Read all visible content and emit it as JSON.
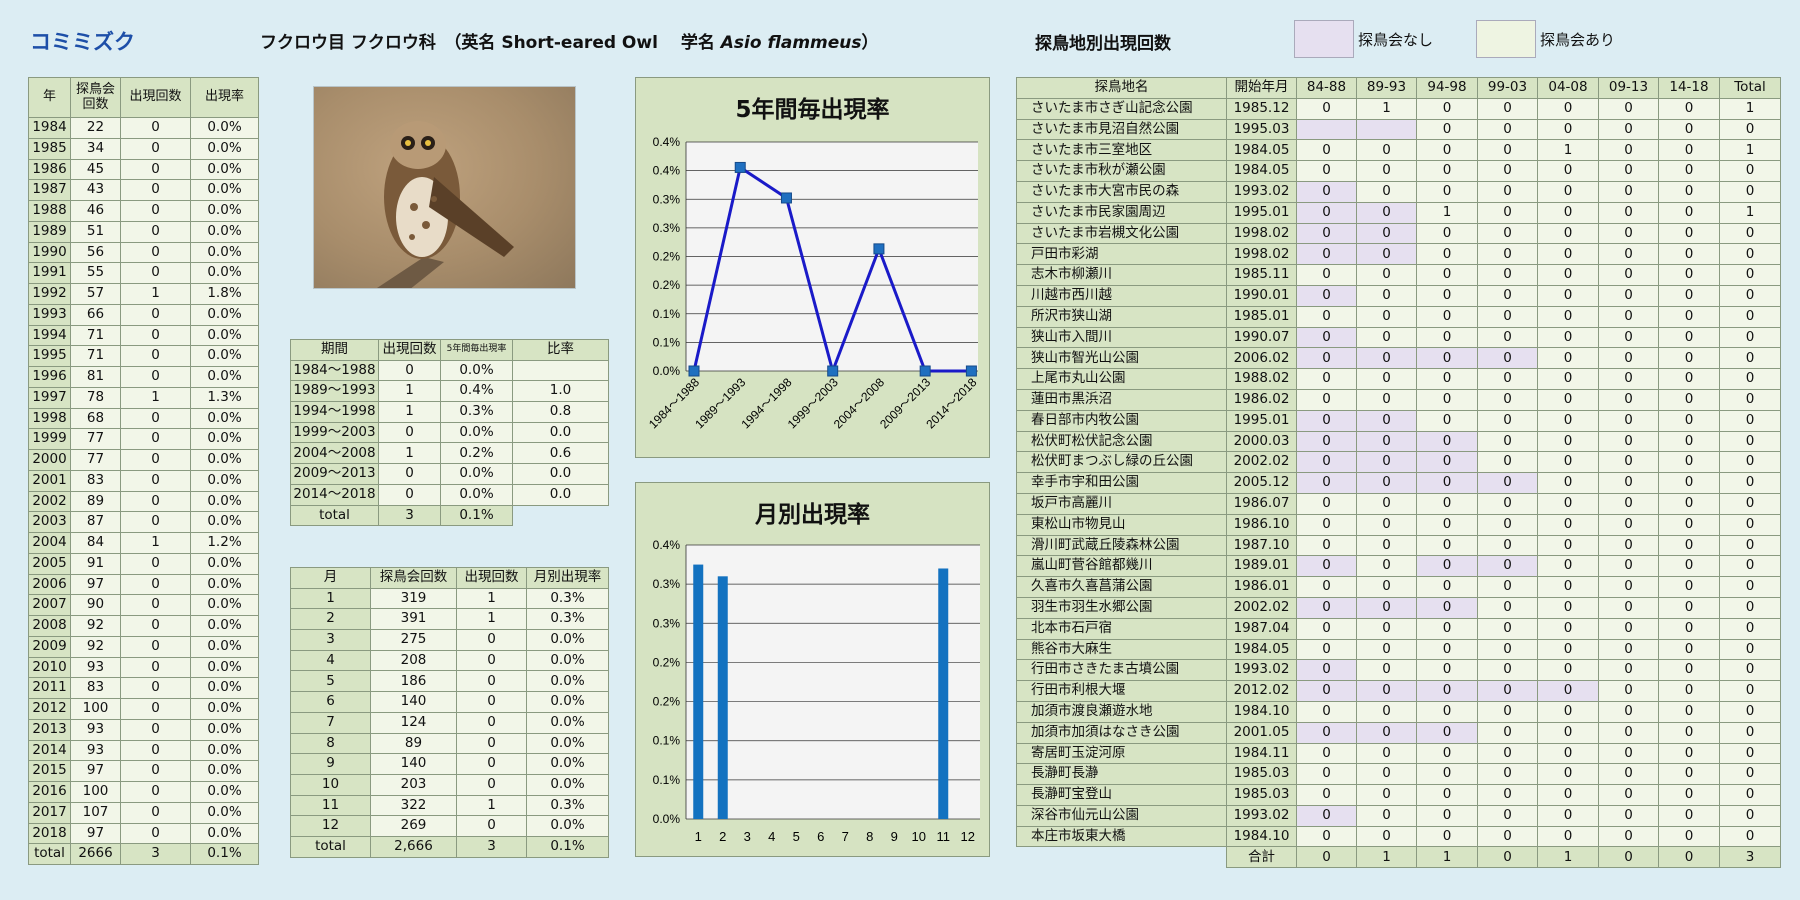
{
  "header": {
    "species": "コミミズク",
    "taxon_prefix": "フクロウ目 フクロウ科　（英名 Short-eared Owl　 学名 ",
    "taxon_latin": "Asio flammeus",
    "taxon_suffix": "）",
    "sites_title": "探鳥地別出現回数",
    "legend_none": "探鳥会なし",
    "legend_held": "探鳥会あり",
    "legend_none_color": "#e6e0f0",
    "legend_held_color": "#eef4e2"
  },
  "photo": {
    "icon": "owl-photo-icon"
  },
  "yearly": {
    "headers": [
      "年",
      "探鳥会回数",
      "出現回数",
      "出現率"
    ],
    "rows": [
      [
        "1984",
        "22",
        "0",
        "0.0%"
      ],
      [
        "1985",
        "34",
        "0",
        "0.0%"
      ],
      [
        "1986",
        "45",
        "0",
        "0.0%"
      ],
      [
        "1987",
        "43",
        "0",
        "0.0%"
      ],
      [
        "1988",
        "46",
        "0",
        "0.0%"
      ],
      [
        "1989",
        "51",
        "0",
        "0.0%"
      ],
      [
        "1990",
        "56",
        "0",
        "0.0%"
      ],
      [
        "1991",
        "55",
        "0",
        "0.0%"
      ],
      [
        "1992",
        "57",
        "1",
        "1.8%"
      ],
      [
        "1993",
        "66",
        "0",
        "0.0%"
      ],
      [
        "1994",
        "71",
        "0",
        "0.0%"
      ],
      [
        "1995",
        "71",
        "0",
        "0.0%"
      ],
      [
        "1996",
        "81",
        "0",
        "0.0%"
      ],
      [
        "1997",
        "78",
        "1",
        "1.3%"
      ],
      [
        "1998",
        "68",
        "0",
        "0.0%"
      ],
      [
        "1999",
        "77",
        "0",
        "0.0%"
      ],
      [
        "2000",
        "77",
        "0",
        "0.0%"
      ],
      [
        "2001",
        "83",
        "0",
        "0.0%"
      ],
      [
        "2002",
        "89",
        "0",
        "0.0%"
      ],
      [
        "2003",
        "87",
        "0",
        "0.0%"
      ],
      [
        "2004",
        "84",
        "1",
        "1.2%"
      ],
      [
        "2005",
        "91",
        "0",
        "0.0%"
      ],
      [
        "2006",
        "97",
        "0",
        "0.0%"
      ],
      [
        "2007",
        "90",
        "0",
        "0.0%"
      ],
      [
        "2008",
        "92",
        "0",
        "0.0%"
      ],
      [
        "2009",
        "92",
        "0",
        "0.0%"
      ],
      [
        "2010",
        "93",
        "0",
        "0.0%"
      ],
      [
        "2011",
        "83",
        "0",
        "0.0%"
      ],
      [
        "2012",
        "100",
        "0",
        "0.0%"
      ],
      [
        "2013",
        "93",
        "0",
        "0.0%"
      ],
      [
        "2014",
        "93",
        "0",
        "0.0%"
      ],
      [
        "2015",
        "97",
        "0",
        "0.0%"
      ],
      [
        "2016",
        "100",
        "0",
        "0.0%"
      ],
      [
        "2017",
        "107",
        "0",
        "0.0%"
      ],
      [
        "2018",
        "97",
        "0",
        "0.0%"
      ]
    ],
    "total": [
      "total",
      "2666",
      "3",
      "0.1%"
    ]
  },
  "periods": {
    "headers": [
      "期間",
      "出現回数",
      "5年間毎出現率",
      "比率"
    ],
    "rows": [
      [
        "1984～1988",
        "0",
        "0.0%",
        ""
      ],
      [
        "1989～1993",
        "1",
        "0.4%",
        "1.0"
      ],
      [
        "1994～1998",
        "1",
        "0.3%",
        "0.8"
      ],
      [
        "1999～2003",
        "0",
        "0.0%",
        "0.0"
      ],
      [
        "2004～2008",
        "1",
        "0.2%",
        "0.6"
      ],
      [
        "2009～2013",
        "0",
        "0.0%",
        "0.0"
      ],
      [
        "2014～2018",
        "0",
        "0.0%",
        "0.0"
      ]
    ],
    "total": [
      "total",
      "3",
      "0.1%"
    ]
  },
  "monthly": {
    "headers": [
      "月",
      "探鳥会回数",
      "出現回数",
      "月別出現率"
    ],
    "rows": [
      [
        "1",
        "319",
        "1",
        "0.3%"
      ],
      [
        "2",
        "391",
        "1",
        "0.3%"
      ],
      [
        "3",
        "275",
        "0",
        "0.0%"
      ],
      [
        "4",
        "208",
        "0",
        "0.0%"
      ],
      [
        "5",
        "186",
        "0",
        "0.0%"
      ],
      [
        "6",
        "140",
        "0",
        "0.0%"
      ],
      [
        "7",
        "124",
        "0",
        "0.0%"
      ],
      [
        "8",
        "89",
        "0",
        "0.0%"
      ],
      [
        "9",
        "140",
        "0",
        "0.0%"
      ],
      [
        "10",
        "203",
        "0",
        "0.0%"
      ],
      [
        "11",
        "322",
        "1",
        "0.3%"
      ],
      [
        "12",
        "269",
        "0",
        "0.0%"
      ]
    ],
    "total": [
      "total",
      "2,666",
      "3",
      "0.1%"
    ]
  },
  "sites": {
    "headers": [
      "探鳥地名",
      "開始年月",
      "84-88",
      "89-93",
      "94-98",
      "99-03",
      "04-08",
      "09-13",
      "14-18",
      "Total"
    ],
    "rows": [
      {
        "name": "さいたま市さぎ山記念公園",
        "start": "1985.12",
        "v": [
          "0",
          "1",
          "0",
          "0",
          "0",
          "0",
          "0",
          "1"
        ],
        "none": []
      },
      {
        "name": "さいたま市見沼自然公園",
        "start": "1995.03",
        "v": [
          "",
          "",
          "0",
          "0",
          "0",
          "0",
          "0",
          "0"
        ],
        "none": [
          0,
          1
        ]
      },
      {
        "name": "さいたま市三室地区",
        "start": "1984.05",
        "v": [
          "0",
          "0",
          "0",
          "0",
          "1",
          "0",
          "0",
          "1"
        ],
        "none": []
      },
      {
        "name": "さいたま市秋が瀬公園",
        "start": "1984.05",
        "v": [
          "0",
          "0",
          "0",
          "0",
          "0",
          "0",
          "0",
          "0"
        ],
        "none": []
      },
      {
        "name": "さいたま市大宮市民の森",
        "start": "1993.02",
        "v": [
          "0",
          "0",
          "0",
          "0",
          "0",
          "0",
          "0",
          "0"
        ],
        "none": [
          0
        ]
      },
      {
        "name": "さいたま市民家園周辺",
        "start": "1995.01",
        "v": [
          "0",
          "0",
          "1",
          "0",
          "0",
          "0",
          "0",
          "1"
        ],
        "none": [
          0,
          1
        ]
      },
      {
        "name": "さいたま市岩槻文化公園",
        "start": "1998.02",
        "v": [
          "0",
          "0",
          "0",
          "0",
          "0",
          "0",
          "0",
          "0"
        ],
        "none": [
          0,
          1
        ]
      },
      {
        "name": "戸田市彩湖",
        "start": "1998.02",
        "v": [
          "0",
          "0",
          "0",
          "0",
          "0",
          "0",
          "0",
          "0"
        ],
        "none": [
          0,
          1
        ]
      },
      {
        "name": "志木市柳瀬川",
        "start": "1985.11",
        "v": [
          "0",
          "0",
          "0",
          "0",
          "0",
          "0",
          "0",
          "0"
        ],
        "none": []
      },
      {
        "name": "川越市西川越",
        "start": "1990.01",
        "v": [
          "0",
          "0",
          "0",
          "0",
          "0",
          "0",
          "0",
          "0"
        ],
        "none": [
          0
        ]
      },
      {
        "name": "所沢市狭山湖",
        "start": "1985.01",
        "v": [
          "0",
          "0",
          "0",
          "0",
          "0",
          "0",
          "0",
          "0"
        ],
        "none": []
      },
      {
        "name": "狭山市入間川",
        "start": "1990.07",
        "v": [
          "0",
          "0",
          "0",
          "0",
          "0",
          "0",
          "0",
          "0"
        ],
        "none": [
          0
        ]
      },
      {
        "name": "狭山市智光山公園",
        "start": "2006.02",
        "v": [
          "0",
          "0",
          "0",
          "0",
          "0",
          "0",
          "0",
          "0"
        ],
        "none": [
          0,
          1,
          2,
          3
        ]
      },
      {
        "name": "上尾市丸山公園",
        "start": "1988.02",
        "v": [
          "0",
          "0",
          "0",
          "0",
          "0",
          "0",
          "0",
          "0"
        ],
        "none": []
      },
      {
        "name": "蓮田市黒浜沼",
        "start": "1986.02",
        "v": [
          "0",
          "0",
          "0",
          "0",
          "0",
          "0",
          "0",
          "0"
        ],
        "none": []
      },
      {
        "name": "春日部市内牧公園",
        "start": "1995.01",
        "v": [
          "0",
          "0",
          "0",
          "0",
          "0",
          "0",
          "0",
          "0"
        ],
        "none": [
          0,
          1
        ]
      },
      {
        "name": "松伏町松伏記念公園",
        "start": "2000.03",
        "v": [
          "0",
          "0",
          "0",
          "0",
          "0",
          "0",
          "0",
          "0"
        ],
        "none": [
          0,
          1,
          2
        ]
      },
      {
        "name": "松伏町まつぶし緑の丘公園",
        "start": "2002.02",
        "v": [
          "0",
          "0",
          "0",
          "0",
          "0",
          "0",
          "0",
          "0"
        ],
        "none": [
          0,
          1,
          2
        ]
      },
      {
        "name": "幸手市宇和田公園",
        "start": "2005.12",
        "v": [
          "0",
          "0",
          "0",
          "0",
          "0",
          "0",
          "0",
          "0"
        ],
        "none": [
          0,
          1,
          2,
          3
        ]
      },
      {
        "name": "坂戸市高麗川",
        "start": "1986.07",
        "v": [
          "0",
          "0",
          "0",
          "0",
          "0",
          "0",
          "0",
          "0"
        ],
        "none": []
      },
      {
        "name": "東松山市物見山",
        "start": "1986.10",
        "v": [
          "0",
          "0",
          "0",
          "0",
          "0",
          "0",
          "0",
          "0"
        ],
        "none": []
      },
      {
        "name": "滑川町武蔵丘陵森林公園",
        "start": "1987.10",
        "v": [
          "0",
          "0",
          "0",
          "0",
          "0",
          "0",
          "0",
          "0"
        ],
        "none": []
      },
      {
        "name": "嵐山町菅谷館都幾川",
        "start": "1989.01",
        "v": [
          "0",
          "0",
          "0",
          "0",
          "0",
          "0",
          "0",
          "0"
        ],
        "none": [
          0,
          2,
          3
        ]
      },
      {
        "name": "久喜市久喜菖蒲公園",
        "start": "1986.01",
        "v": [
          "0",
          "0",
          "0",
          "0",
          "0",
          "0",
          "0",
          "0"
        ],
        "none": []
      },
      {
        "name": "羽生市羽生水郷公園",
        "start": "2002.02",
        "v": [
          "0",
          "0",
          "0",
          "0",
          "0",
          "0",
          "0",
          "0"
        ],
        "none": [
          0,
          1,
          2
        ]
      },
      {
        "name": "北本市石戸宿",
        "start": "1987.04",
        "v": [
          "0",
          "0",
          "0",
          "0",
          "0",
          "0",
          "0",
          "0"
        ],
        "none": []
      },
      {
        "name": "熊谷市大麻生",
        "start": "1984.05",
        "v": [
          "0",
          "0",
          "0",
          "0",
          "0",
          "0",
          "0",
          "0"
        ],
        "none": []
      },
      {
        "name": "行田市さきたま古墳公園",
        "start": "1993.02",
        "v": [
          "0",
          "0",
          "0",
          "0",
          "0",
          "0",
          "0",
          "0"
        ],
        "none": [
          0
        ]
      },
      {
        "name": "行田市利根大堰",
        "start": "2012.02",
        "v": [
          "0",
          "0",
          "0",
          "0",
          "0",
          "0",
          "0",
          "0"
        ],
        "none": [
          0,
          1,
          2,
          3,
          4
        ]
      },
      {
        "name": "加須市渡良瀬遊水地",
        "start": "1984.10",
        "v": [
          "0",
          "0",
          "0",
          "0",
          "0",
          "0",
          "0",
          "0"
        ],
        "none": []
      },
      {
        "name": "加須市加須はなさき公園",
        "start": "2001.05",
        "v": [
          "0",
          "0",
          "0",
          "0",
          "0",
          "0",
          "0",
          "0"
        ],
        "none": [
          0,
          1,
          2
        ]
      },
      {
        "name": "寄居町玉淀河原",
        "start": "1984.11",
        "v": [
          "0",
          "0",
          "0",
          "0",
          "0",
          "0",
          "0",
          "0"
        ],
        "none": []
      },
      {
        "name": "長瀞町長瀞",
        "start": "1985.03",
        "v": [
          "0",
          "0",
          "0",
          "0",
          "0",
          "0",
          "0",
          "0"
        ],
        "none": []
      },
      {
        "name": "長瀞町宝登山",
        "start": "1985.03",
        "v": [
          "0",
          "0",
          "0",
          "0",
          "0",
          "0",
          "0",
          "0"
        ],
        "none": []
      },
      {
        "name": "深谷市仙元山公園",
        "start": "1993.02",
        "v": [
          "0",
          "0",
          "0",
          "0",
          "0",
          "0",
          "0",
          "0"
        ],
        "none": [
          0
        ]
      },
      {
        "name": "本庄市坂東大橋",
        "start": "1984.10",
        "v": [
          "0",
          "0",
          "0",
          "0",
          "0",
          "0",
          "0",
          "0"
        ],
        "none": []
      }
    ],
    "total_label": "合計",
    "total": [
      "0",
      "1",
      "1",
      "0",
      "1",
      "0",
      "0",
      "3"
    ]
  },
  "chart_data": [
    {
      "type": "line",
      "title": "5年間毎出現率",
      "categories": [
        "1984～1988",
        "1989～1993",
        "1994～1998",
        "1999～2003",
        "2004～2008",
        "2009～2013",
        "2014～2018"
      ],
      "values": [
        0.0,
        0.4,
        0.34,
        0.0,
        0.24,
        0.0,
        0.0
      ],
      "yticks": [
        "0.0%",
        "0.1%",
        "0.1%",
        "0.2%",
        "0.2%",
        "0.3%",
        "0.3%",
        "0.4%",
        "0.4%"
      ],
      "ylim": [
        0,
        0.45
      ],
      "color": "#1a1ac8",
      "marker_color": "#1f6fc0",
      "grid": true
    },
    {
      "type": "bar",
      "title": "月別出現率",
      "categories": [
        "1",
        "2",
        "3",
        "4",
        "5",
        "6",
        "7",
        "8",
        "9",
        "10",
        "11",
        "12"
      ],
      "values": [
        0.325,
        0.31,
        0,
        0,
        0,
        0,
        0,
        0,
        0,
        0,
        0.32,
        0
      ],
      "yticks": [
        "0.0%",
        "0.1%",
        "0.1%",
        "0.2%",
        "0.2%",
        "0.3%",
        "0.3%",
        "0.4%"
      ],
      "ylim": [
        0,
        0.35
      ],
      "color": "#1372c0",
      "grid": true
    }
  ]
}
